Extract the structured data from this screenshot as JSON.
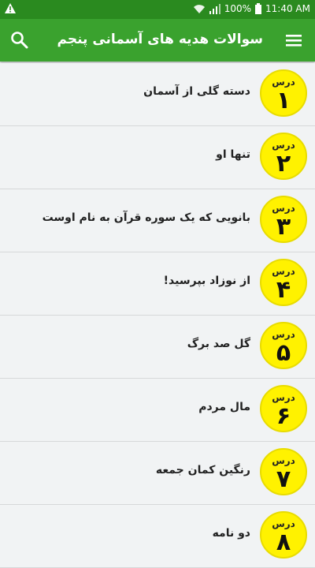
{
  "status_bar": {
    "battery": "100%",
    "time": "11:40 AM",
    "warning_icon": "warning-icon",
    "wifi_icon": "wifi-icon",
    "signal_icon": "signal-icon",
    "battery_icon": "battery-icon"
  },
  "app_bar": {
    "title": "سوالات هدیه های آسمانی پنجم",
    "menu_icon": "hamburger-menu-icon",
    "search_icon": "search-icon",
    "color": "#3aa22e"
  },
  "lessons": [
    {
      "word": "درس",
      "number": "۱",
      "title": "دسته گلی از آسمان"
    },
    {
      "word": "درس",
      "number": "۲",
      "title": "تنها او"
    },
    {
      "word": "درس",
      "number": "۳",
      "title": "بانویی که یک سوره قرآن به نام اوست"
    },
    {
      "word": "درس",
      "number": "۴",
      "title": "از نوزاد بپرسید!"
    },
    {
      "word": "درس",
      "number": "۵",
      "title": "گل صد برگ"
    },
    {
      "word": "درس",
      "number": "۶",
      "title": "مال مردم"
    },
    {
      "word": "درس",
      "number": "۷",
      "title": "رنگین کمان جمعه"
    },
    {
      "word": "درس",
      "number": "۸",
      "title": "دو نامه"
    }
  ],
  "badge_color": "#fff200"
}
